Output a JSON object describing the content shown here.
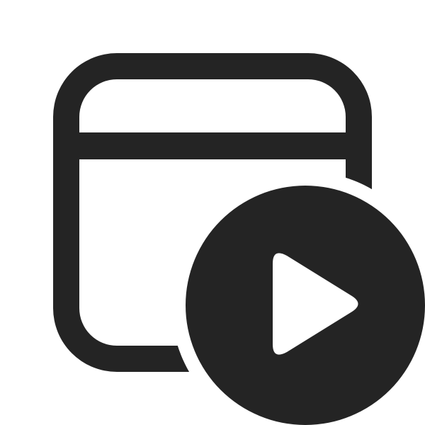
{
  "icon": {
    "name": "app-window-play-icon",
    "color": "#242424",
    "background": "#ffffff"
  }
}
